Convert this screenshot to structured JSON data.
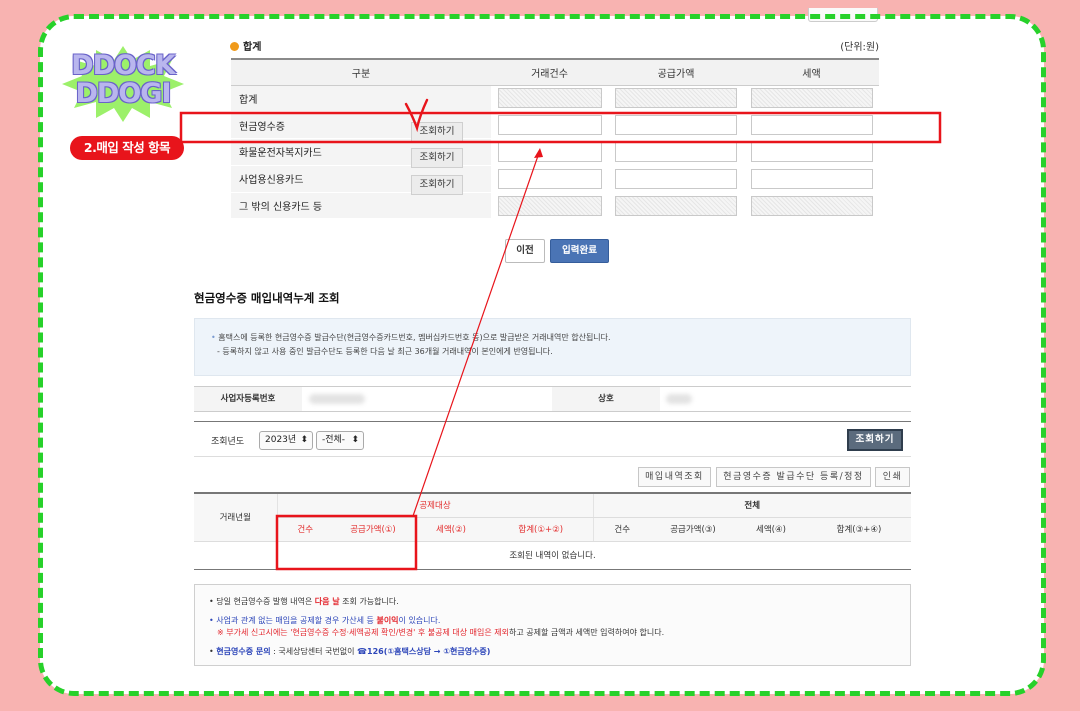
{
  "logo": {
    "line1": "DDOCK",
    "line2": "DDOGI"
  },
  "step_pill": "2.매입 작성 항목",
  "summary": {
    "title": "합계",
    "unit": "(단위:원)",
    "headers": [
      "구분",
      "거래건수",
      "공급가액",
      "세액"
    ],
    "rows": [
      {
        "label": "합계",
        "button": ""
      },
      {
        "label": "현금영수증",
        "button": "조회하기"
      },
      {
        "label": "화물운전자복지카드",
        "button": "조회하기"
      },
      {
        "label": "사업용신용카드",
        "button": "조회하기"
      },
      {
        "label": "그 밖의 신용카드 등",
        "button": ""
      }
    ]
  },
  "buttons": {
    "prev": "이전",
    "done": "입력완료"
  },
  "inquiry": {
    "title": "현금영수증 매입내역누계 조회",
    "info_line1": "홈택스에 등록한 현금영수증 발급수단(현금영수증카드번호, 멤버십카드번호 등)으로 발급받은 거래내역만 합산됩니다.",
    "info_line2": "- 등록하지 않고 사용 중인 발급수단도 등록한 다음 날 최근 36개월 거래내역이 본인에게 반영됩니다.",
    "biz_no_label": "사업자등록번호",
    "company_label": "상호",
    "year_label": "조회년도",
    "year_value": "2023년",
    "period_value": "-전체-",
    "search_button": "조회하기",
    "toolbar": [
      "매입내역조회",
      "현금영수증 발급수단 등록/정정",
      "인쇄"
    ],
    "table": {
      "month_header": "거래년월",
      "group1": "공제대상",
      "group2": "전체",
      "sub_headers": [
        "건수",
        "공급가액(①)",
        "세액(②)",
        "합계(①+②)",
        "건수",
        "공급가액(③)",
        "세액(④)",
        "합계(③+④)"
      ],
      "empty": "조회된 내역이 없습니다."
    }
  },
  "notes": {
    "n1_a": "당일 현금영수증 발행 내역은 ",
    "n1_b": "다음 날",
    "n1_c": " 조회 가능합니다.",
    "n2_a": "사업과 관계 없는 매입을 공제할 경우 가산세 등 ",
    "n2_b": "불이익",
    "n2_c": "이 있습니다.",
    "n3_a": "※ 부가세 신고시에는 '현금영수증 수정·세액공제 확인/변경' 후 불공제 대상 매입은 제외",
    "n3_b": "하고 공제할 금액과 세액만 입력하여야 합니다.",
    "n4_a": "현금영수증 문의",
    "n4_b": " : 국세상담센터 국번없이 ",
    "n4_c": "☎126(①홈택스상담 → ①현금영수증)"
  },
  "colors": {
    "accent_red": "#e8141b",
    "frame_green": "#27d12a",
    "bg_pink": "#f8b3b1",
    "button_blue": "#4a74b5"
  }
}
